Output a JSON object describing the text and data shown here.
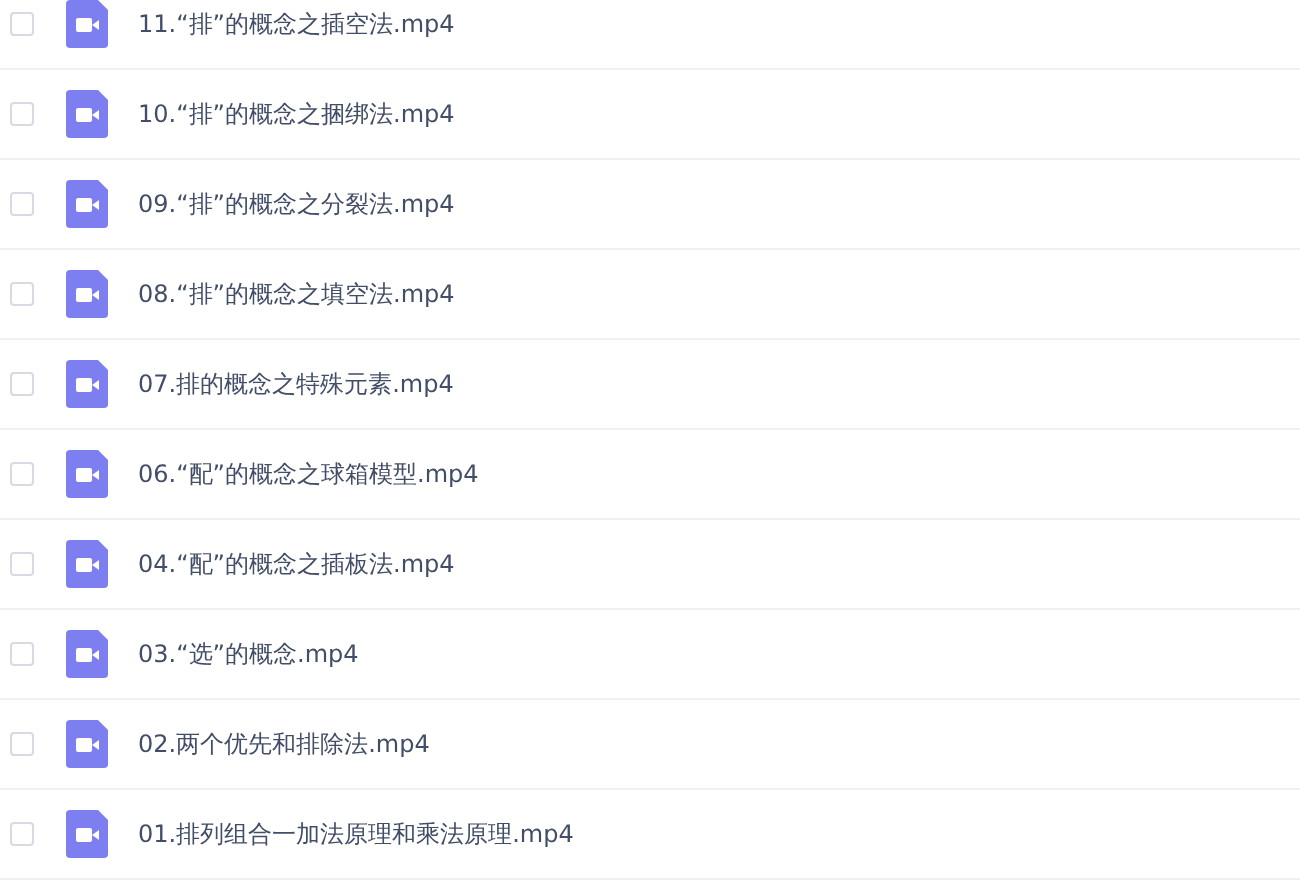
{
  "files": [
    {
      "name": "11.“排”的概念之插空法.mp4",
      "checked": false
    },
    {
      "name": "10.“排”的概念之捆绑法.mp4",
      "checked": false
    },
    {
      "name": "09.“排”的概念之分裂法.mp4",
      "checked": false
    },
    {
      "name": "08.“排”的概念之填空法.mp4",
      "checked": false
    },
    {
      "name": "07.排的概念之特殊元素.mp4",
      "checked": false
    },
    {
      "name": "06.“配”的概念之球箱模型.mp4",
      "checked": false
    },
    {
      "name": "04.“配”的概念之插板法.mp4",
      "checked": false
    },
    {
      "name": "03.“选”的概念.mp4",
      "checked": false
    },
    {
      "name": "02.两个优先和排除法.mp4",
      "checked": false
    },
    {
      "name": "01.排列组合一加法原理和乘法原理.mp4",
      "checked": false
    }
  ]
}
